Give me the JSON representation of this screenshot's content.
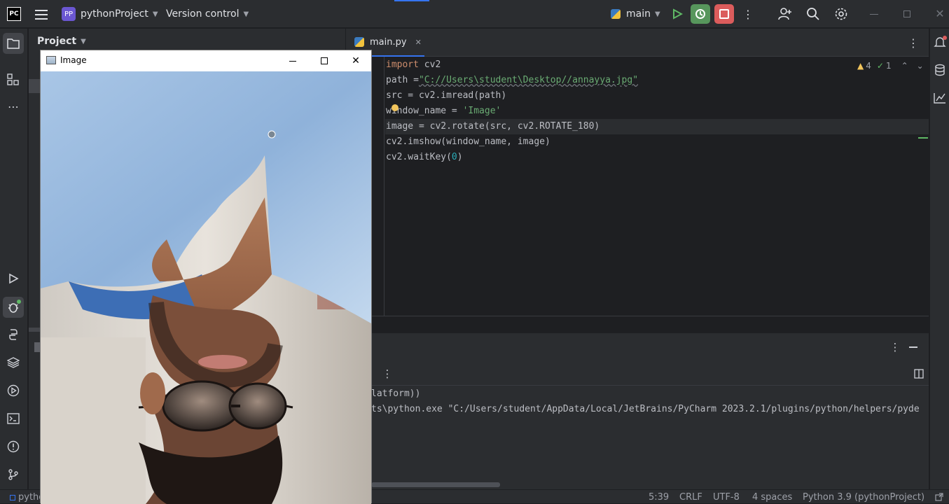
{
  "titlebar": {
    "app_logo": "PC",
    "project_badge": "PP",
    "project_name": "pythonProject",
    "vcs_label": "Version control",
    "run_config": "main"
  },
  "project_panel": {
    "title": "Project"
  },
  "editor": {
    "tab_label": "main.py",
    "warnings_count": "4",
    "checks_count": "1",
    "lines": [
      {
        "t": "import",
        "rest": " cv2"
      },
      {
        "a": "path =",
        "s": "\"C://Users\\student\\Desktop//annayya.jpg\""
      },
      {
        "plain": "src = cv2.imread(path)"
      },
      {
        "a": "window_name = ",
        "s": "'Image'"
      },
      {
        "plain": "image = cv2.rotate(src, cv2.ROTATE_180)"
      },
      {
        "plain": "cv2.imshow(window_name, image)"
      },
      {
        "a": "cv2.waitKey(",
        "n": "0",
        "b": ")"
      }
    ]
  },
  "console": {
    "line1": "latform))",
    "line2": "ts\\python.exe \"C:/Users/student/AppData/Local/JetBrains/PyCharm 2023.2.1/plugins/python/helpers/pyde"
  },
  "statusbar": {
    "left_text": "pytho",
    "position": "5:39",
    "line_sep": "CRLF",
    "encoding": "UTF-8",
    "indent": "4 spaces",
    "interpreter": "Python 3.9 (pythonProject)"
  },
  "image_window": {
    "title": "Image"
  },
  "colors": {
    "accent_green": "#5fb865",
    "stop_red": "#db5c5c",
    "debug_green": "#57965c",
    "project_badge": "#6b57d2"
  }
}
